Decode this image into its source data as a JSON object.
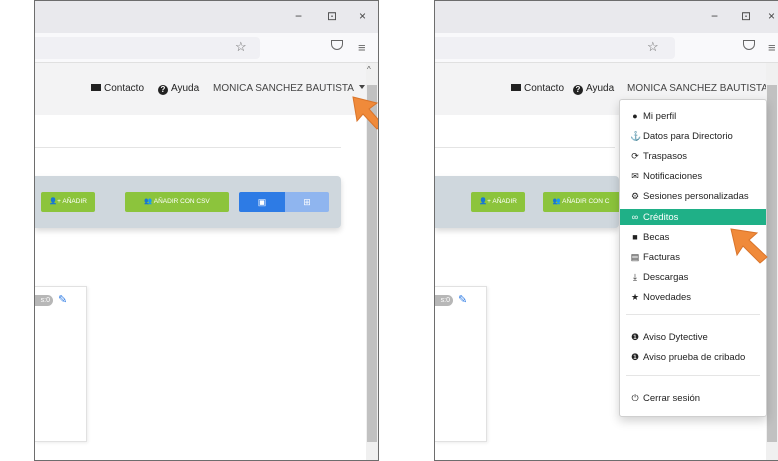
{
  "window": {
    "minimize_glyph": "−",
    "maximize_glyph": "⊡",
    "close_glyph": "×",
    "bookmark_glyph": "☆",
    "menu_glyph": "≡",
    "scroll_up_glyph": "^"
  },
  "navbar": {
    "contact_label": "Contacto",
    "help_label": "Ayuda",
    "user_name": "MONICA SANCHEZ BAUTISTA"
  },
  "toolbar": {
    "add_label": "AÑADIR",
    "add_csv_label": "AÑADIR CON CSV",
    "add_csv_label_clipped": "AÑADIR CON C"
  },
  "card": {
    "count_badge": "s:0"
  },
  "dropdown_menu": {
    "items": [
      {
        "label": "Mi perfil",
        "icon": "user-icon"
      },
      {
        "label": "Datos para Directorio",
        "icon": "anchor-icon"
      },
      {
        "label": "Traspasos",
        "icon": "refresh-icon"
      },
      {
        "label": "Notificaciones",
        "icon": "envelope-icon"
      },
      {
        "label": "Sesiones personalizadas",
        "icon": "cogs-icon"
      },
      {
        "label": "Créditos",
        "icon": "infinity-icon"
      },
      {
        "label": "Becas",
        "icon": "gift-icon"
      },
      {
        "label": "Facturas",
        "icon": "invoice-icon"
      },
      {
        "label": "Descargas",
        "icon": "download-icon"
      },
      {
        "label": "Novedades",
        "icon": "star-icon"
      },
      {
        "label": "Aviso Dytective",
        "icon": "alert-icon"
      },
      {
        "label": "Aviso prueba de cribado",
        "icon": "alert-icon"
      },
      {
        "label": "Cerrar sesión",
        "icon": "power-icon"
      }
    ],
    "active_item": "Créditos"
  },
  "colors": {
    "accent_green": "#8cc43c",
    "active_teal": "#1fb087",
    "primary_blue": "#2d7be5",
    "arrow_orange": "#f08a3a"
  }
}
